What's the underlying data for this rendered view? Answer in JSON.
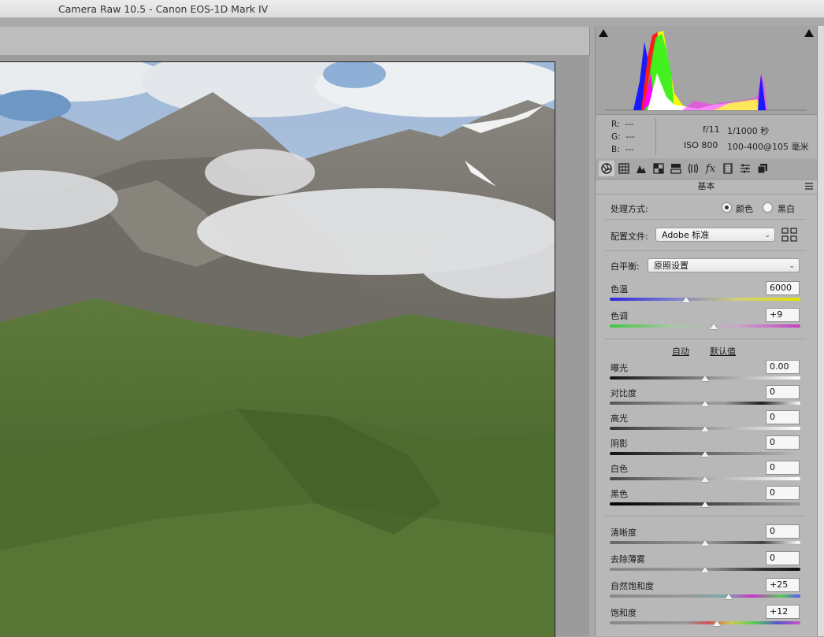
{
  "window": {
    "title": "Camera Raw 10.5 -  Canon EOS-1D Mark IV"
  },
  "info": {
    "r_label": "R:",
    "r_value": "---",
    "g_label": "G:",
    "g_value": "---",
    "b_label": "B:",
    "b_value": "---",
    "aperture": "f/11",
    "shutter": "1/1000 秒",
    "iso": "ISO 800",
    "lens": "100-400@105 毫米"
  },
  "tabs": [
    "basic-tab",
    "tone-curve-tab",
    "detail-tab",
    "hsl-tab",
    "split-toning-tab",
    "lens-corrections-tab",
    "effects-tab",
    "camera-calibration-tab",
    "presets-tab",
    "snapshots-tab"
  ],
  "panel": {
    "section_title": "基本",
    "process_label": "处理方式:",
    "process_color": "颜色",
    "process_bw": "黑白",
    "process_selected": "颜色",
    "profile_label": "配置文件:",
    "profile_value": "Adobe 标准",
    "wb_label": "白平衡:",
    "wb_value": "原照设置",
    "auto_label": "自动",
    "default_label": "默认值"
  },
  "sliders": [
    {
      "key": "temp",
      "label": "色温",
      "value": "6000",
      "pos": 0.4
    },
    {
      "key": "tint",
      "label": "色调",
      "value": "+9",
      "pos": 0.546
    },
    {
      "key": "exposure",
      "label": "曝光",
      "value": "0.00",
      "pos": 0.5
    },
    {
      "key": "contrast",
      "label": "对比度",
      "value": "0",
      "pos": 0.5
    },
    {
      "key": "highlights",
      "label": "高光",
      "value": "0",
      "pos": 0.5
    },
    {
      "key": "shadows",
      "label": "阴影",
      "value": "0",
      "pos": 0.5
    },
    {
      "key": "whites",
      "label": "白色",
      "value": "0",
      "pos": 0.5
    },
    {
      "key": "blacks",
      "label": "黑色",
      "value": "0",
      "pos": 0.5
    },
    {
      "key": "clarity",
      "label": "清晰度",
      "value": "0",
      "pos": 0.5
    },
    {
      "key": "dehaze",
      "label": "去除薄雾",
      "value": "0",
      "pos": 0.5
    },
    {
      "key": "vibrance",
      "label": "自然饱和度",
      "value": "+25",
      "pos": 0.625
    },
    {
      "key": "saturation",
      "label": "饱和度",
      "value": "+12",
      "pos": 0.56
    }
  ]
}
